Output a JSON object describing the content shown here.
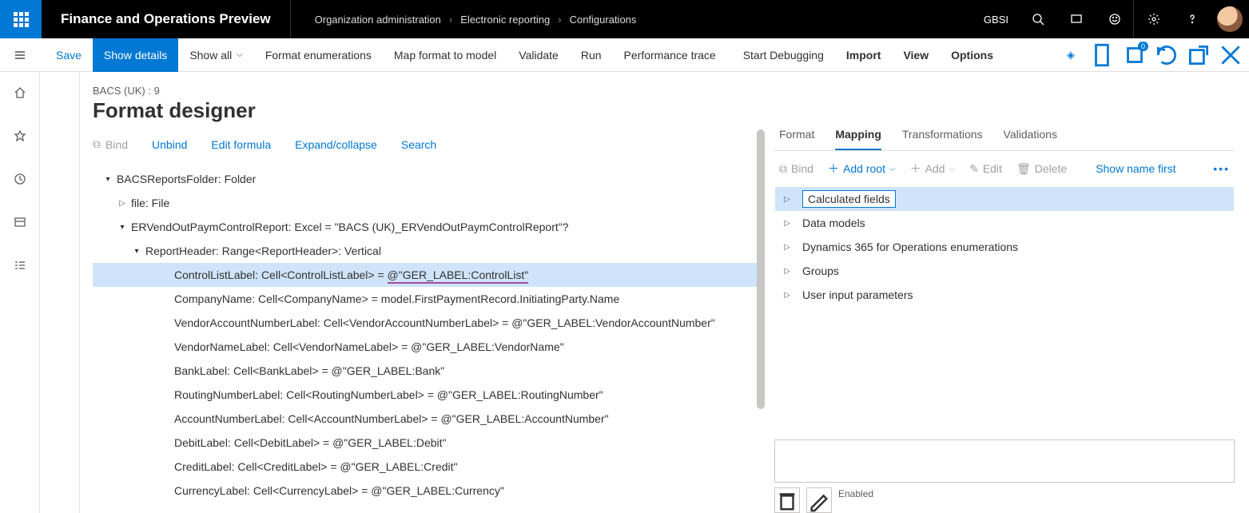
{
  "topbar": {
    "app_title": "Finance and Operations Preview",
    "breadcrumb": [
      "Organization administration",
      "Electronic reporting",
      "Configurations"
    ],
    "company": "GBSI"
  },
  "cmdbar": {
    "save": "Save",
    "show_details": "Show details",
    "show_all": "Show all",
    "format_enums": "Format enumerations",
    "map_format": "Map format to model",
    "validate": "Validate",
    "run": "Run",
    "perf_trace": "Performance trace",
    "start_debug": "Start Debugging",
    "import": "Import",
    "view": "View",
    "options": "Options",
    "badge_count": "0"
  },
  "page": {
    "subtitle": "BACS (UK) : 9",
    "title": "Format designer"
  },
  "toolbar": {
    "bind": "Bind",
    "unbind": "Unbind",
    "edit_formula": "Edit formula",
    "expand": "Expand/collapse",
    "search": "Search"
  },
  "tree": [
    {
      "indent": 0,
      "arrow": "expanded",
      "text": "BACSReportsFolder: Folder",
      "selected": false
    },
    {
      "indent": 1,
      "arrow": "collapsed",
      "text": "file: File",
      "selected": false
    },
    {
      "indent": 1,
      "arrow": "expanded",
      "text": "ERVendOutPaymControlReport: Excel = \"BACS (UK)_ERVendOutPaymControlReport\"?",
      "selected": false
    },
    {
      "indent": 2,
      "arrow": "expanded",
      "text": "ReportHeader: Range<ReportHeader>: Vertical",
      "selected": false
    },
    {
      "indent": 3,
      "arrow": "none",
      "text": "ControlListLabel: Cell<ControlListLabel> = @\"GER_LABEL:ControlList\"",
      "selected": true,
      "underline": true
    },
    {
      "indent": 3,
      "arrow": "none",
      "text": "CompanyName: Cell<CompanyName> = model.FirstPaymentRecord.InitiatingParty.Name",
      "selected": false
    },
    {
      "indent": 3,
      "arrow": "none",
      "text": "VendorAccountNumberLabel: Cell<VendorAccountNumberLabel> = @\"GER_LABEL:VendorAccountNumber\"",
      "selected": false
    },
    {
      "indent": 3,
      "arrow": "none",
      "text": "VendorNameLabel: Cell<VendorNameLabel> = @\"GER_LABEL:VendorName\"",
      "selected": false
    },
    {
      "indent": 3,
      "arrow": "none",
      "text": "BankLabel: Cell<BankLabel> = @\"GER_LABEL:Bank\"",
      "selected": false
    },
    {
      "indent": 3,
      "arrow": "none",
      "text": "RoutingNumberLabel: Cell<RoutingNumberLabel> = @\"GER_LABEL:RoutingNumber\"",
      "selected": false
    },
    {
      "indent": 3,
      "arrow": "none",
      "text": "AccountNumberLabel: Cell<AccountNumberLabel> = @\"GER_LABEL:AccountNumber\"",
      "selected": false
    },
    {
      "indent": 3,
      "arrow": "none",
      "text": "DebitLabel: Cell<DebitLabel> = @\"GER_LABEL:Debit\"",
      "selected": false
    },
    {
      "indent": 3,
      "arrow": "none",
      "text": "CreditLabel: Cell<CreditLabel> = @\"GER_LABEL:Credit\"",
      "selected": false
    },
    {
      "indent": 3,
      "arrow": "none",
      "text": "CurrencyLabel: Cell<CurrencyLabel> = @\"GER_LABEL:Currency\"",
      "selected": false
    }
  ],
  "right": {
    "tabs": {
      "format": "Format",
      "mapping": "Mapping",
      "transformations": "Transformations",
      "validations": "Validations",
      "active": "Mapping"
    },
    "toolbar": {
      "bind": "Bind",
      "add_root": "Add root",
      "add": "Add",
      "edit": "Edit",
      "delete": "Delete",
      "show_name": "Show name first"
    },
    "ds": [
      {
        "label": "Calculated fields",
        "selected": true
      },
      {
        "label": "Data models",
        "selected": false
      },
      {
        "label": "Dynamics 365 for Operations enumerations",
        "selected": false
      },
      {
        "label": "Groups",
        "selected": false
      },
      {
        "label": "User input parameters",
        "selected": false
      }
    ],
    "enabled": "Enabled"
  }
}
